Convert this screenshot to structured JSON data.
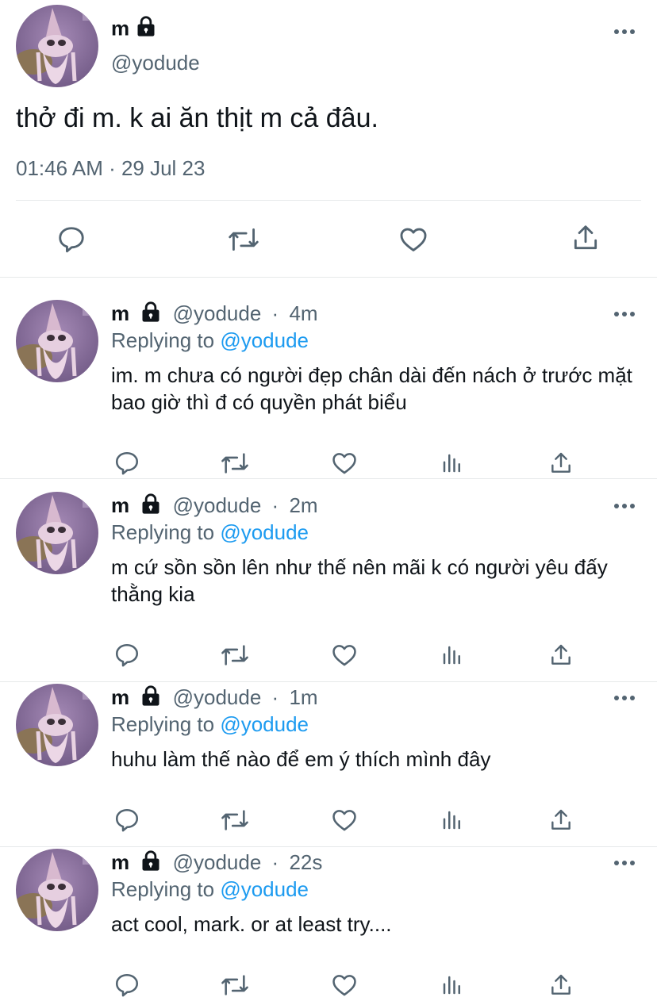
{
  "main_tweet": {
    "name": "m",
    "handle": "@yodude",
    "text": "thở đi m. k ai ăn thịt m cả đâu.",
    "timestamp": "01:46 AM · 29 Jul 23",
    "actions": [
      "reply-icon",
      "retweet-icon",
      "like-icon",
      "share-icon"
    ]
  },
  "replies": [
    {
      "name": "m",
      "handle": "@yodude",
      "sep": "·",
      "time": "4m",
      "replying_label": "Replying to",
      "replying_to": "@yodude",
      "text": "im. m chưa có người đẹp chân dài đến nách ở trước mặt bao giờ thì đ có quyền phát biểu"
    },
    {
      "name": "m",
      "handle": "@yodude",
      "sep": "·",
      "time": "2m",
      "replying_label": "Replying to",
      "replying_to": "@yodude",
      "text": "m cứ sồn sồn lên như thế nên mãi k có người yêu đấy thằng kia"
    },
    {
      "name": "m",
      "handle": "@yodude",
      "sep": "·",
      "time": "1m",
      "replying_label": "Replying to",
      "replying_to": "@yodude",
      "text": "huhu làm thế nào để em ý thích mình đây"
    },
    {
      "name": "m",
      "handle": "@yodude",
      "sep": "·",
      "time": "22s",
      "replying_label": "Replying to",
      "replying_to": "@yodude",
      "text": "act cool, mark. or at least try...."
    }
  ],
  "colors": {
    "accent": "#1d9bf0",
    "secondary": "#536471",
    "divider": "#e6e9ea"
  }
}
